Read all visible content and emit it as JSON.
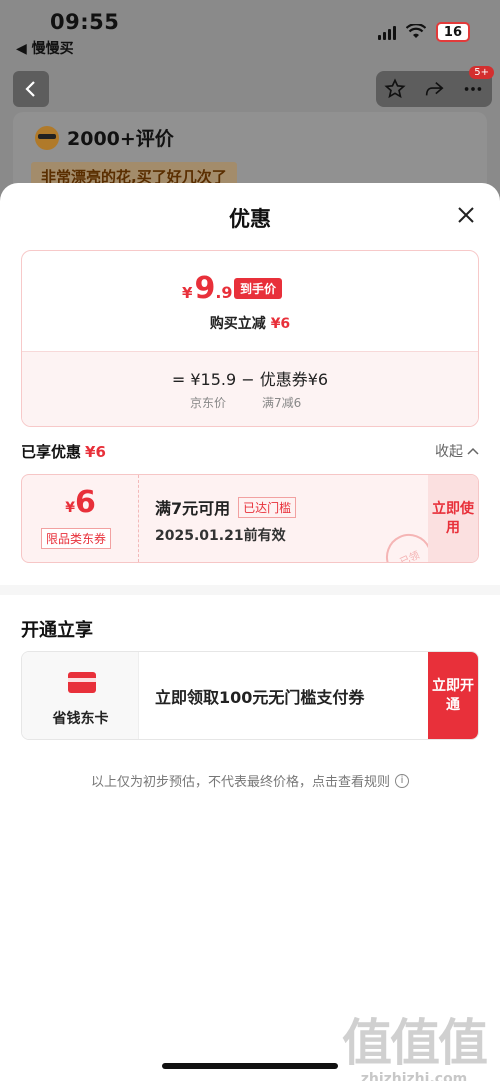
{
  "status_bar": {
    "time": "09:55",
    "back_app": "◀ 慢慢买",
    "battery": "16"
  },
  "background_page": {
    "nav_badge": "5+",
    "review_title": "2000+评价",
    "review_quote": "非常漂亮的花,买了好几次了"
  },
  "sheet": {
    "title": "优惠",
    "price_card": {
      "currency": "¥",
      "price_int": "9",
      "price_dec": ".9",
      "hand_tag": "到手价",
      "discount_label": "购买立减",
      "discount_amount": "¥6",
      "formula": "= ¥15.9 − 优惠券¥6",
      "formula_left_note": "京东价",
      "formula_right_note": "满7减6"
    },
    "enjoyed": {
      "label": "已享优惠",
      "amount": "¥6",
      "collapse_label": "收起"
    },
    "coupon": {
      "currency": "¥",
      "value": "6",
      "type": "限品类东券",
      "condition": "满7元可用",
      "threshold_tag": "已达门槛",
      "expiry": "2025.01.21前有效",
      "use_label": "立即使用",
      "stamp": "已领"
    },
    "open_section": {
      "title": "开通立享",
      "card_name": "省钱东卡",
      "promo_text": "立即领取100元无门槛支付券",
      "open_label": "立即开通"
    },
    "disclaimer": "以上仅为初步预估，不代表最终价格，点击查看规则"
  },
  "watermark": {
    "logo": "值值值",
    "url": "zhizhizhi.com"
  },
  "colors": {
    "accent": "#e8303a",
    "overlay": "#7f7f7f"
  }
}
